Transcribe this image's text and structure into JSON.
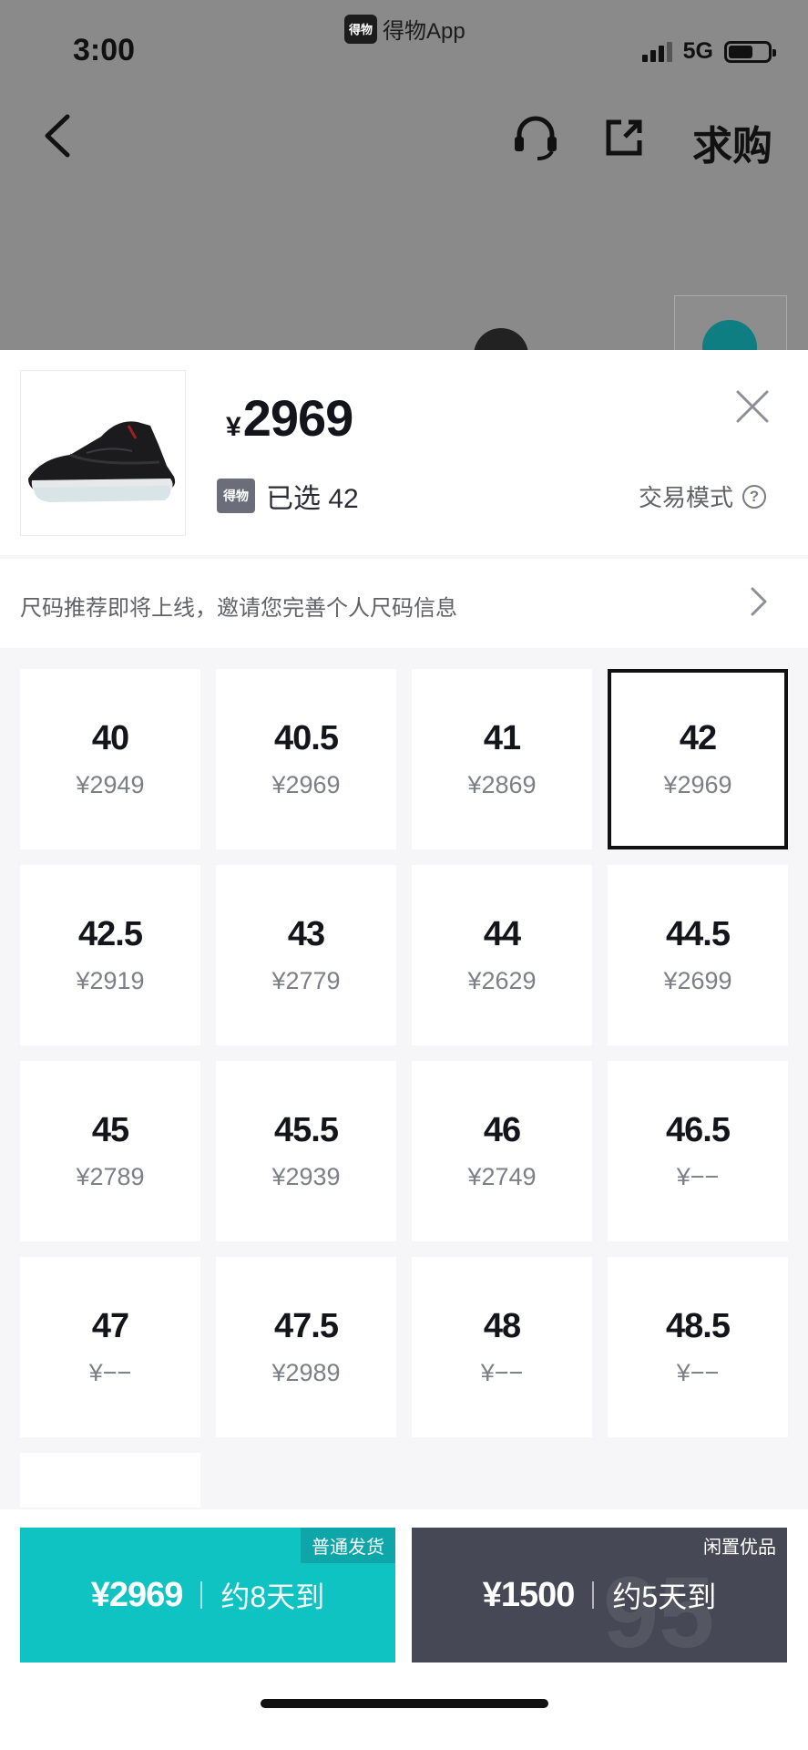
{
  "status_bar": {
    "time": "3:00",
    "app_logo": "得物",
    "app_name": "得物App",
    "network": "5G",
    "battery_icon": "battery-icon"
  },
  "nav": {
    "back_icon": "chevron-left-icon",
    "service_icon": "headset-icon",
    "share_icon": "share-icon",
    "want_label": "求购"
  },
  "product": {
    "price_currency": "¥",
    "price": "2969",
    "brand_logo": "得物",
    "selected_text": "已选 42",
    "trade_mode_label": "交易模式",
    "help_icon": "?"
  },
  "size_banner": {
    "text": "尺码推荐即将上线，邀请您完善个人尺码信息"
  },
  "sizes": [
    {
      "size": "40",
      "price": "¥2949"
    },
    {
      "size": "40.5",
      "price": "¥2969"
    },
    {
      "size": "41",
      "price": "¥2869"
    },
    {
      "size": "42",
      "price": "¥2969",
      "selected": true
    },
    {
      "size": "42.5",
      "price": "¥2919"
    },
    {
      "size": "43",
      "price": "¥2779"
    },
    {
      "size": "44",
      "price": "¥2629"
    },
    {
      "size": "44.5",
      "price": "¥2699"
    },
    {
      "size": "45",
      "price": "¥2789"
    },
    {
      "size": "45.5",
      "price": "¥2939"
    },
    {
      "size": "46",
      "price": "¥2749"
    },
    {
      "size": "46.5",
      "price": "¥−−"
    },
    {
      "size": "47",
      "price": "¥−−"
    },
    {
      "size": "47.5",
      "price": "¥2989"
    },
    {
      "size": "48",
      "price": "¥−−"
    },
    {
      "size": "48.5",
      "price": "¥−−"
    },
    {
      "size": "",
      "price": ""
    }
  ],
  "buy_options": [
    {
      "tag": "普通发货",
      "price": "¥2969",
      "eta": "约8天到",
      "color": "#10c3c3"
    },
    {
      "tag": "闲置优品",
      "price": "¥1500",
      "eta": "约5天到",
      "color": "#464855"
    }
  ]
}
